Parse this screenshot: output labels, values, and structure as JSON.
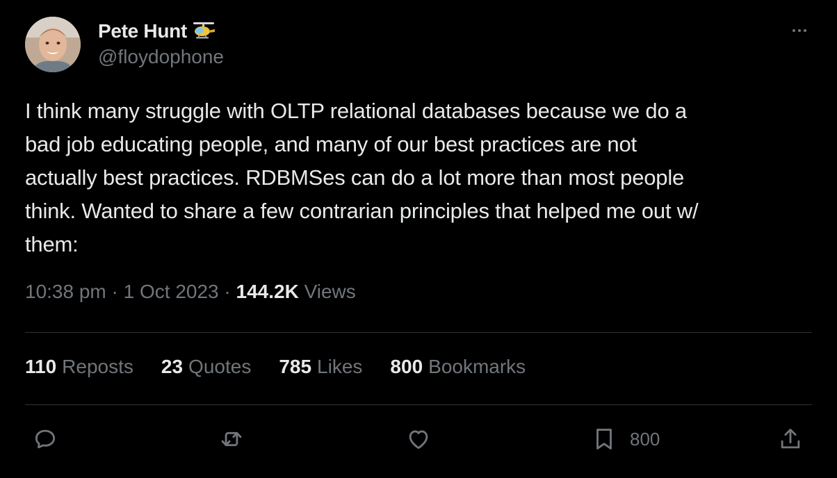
{
  "author": {
    "display_name": "Pete Hunt",
    "handle": "@floydophone",
    "badge_icon": "helicopter-icon",
    "avatar_icon": "avatar-photo"
  },
  "more_icon": "more-dots-icon",
  "tweet": {
    "text": "I think many struggle with OLTP relational databases because we do a\nbad job educating people, and many of our best practices are not\nactually best practices. RDBMSes can do a lot more than most people\nthink. Wanted to share a few contrarian principles that helped me out w/\nthem:"
  },
  "meta": {
    "time": "10:38 pm",
    "separator": " · ",
    "date": "1 Oct 2023",
    "views_count": "144.2K",
    "views_label": "Views"
  },
  "stats": {
    "reposts_count": "110",
    "reposts_label": "Reposts",
    "quotes_count": "23",
    "quotes_label": "Quotes",
    "likes_count": "785",
    "likes_label": "Likes",
    "bookmarks_count": "800",
    "bookmarks_label": "Bookmarks"
  },
  "actions": {
    "reply_icon": "reply-icon",
    "repost_icon": "repost-icon",
    "like_icon": "heart-icon",
    "bookmark_icon": "bookmark-icon",
    "bookmark_count": "800",
    "share_icon": "share-icon"
  },
  "colors": {
    "background": "#000000",
    "primary_text": "#e7e9ea",
    "secondary_text": "#71767b",
    "divider": "#2f3336"
  }
}
